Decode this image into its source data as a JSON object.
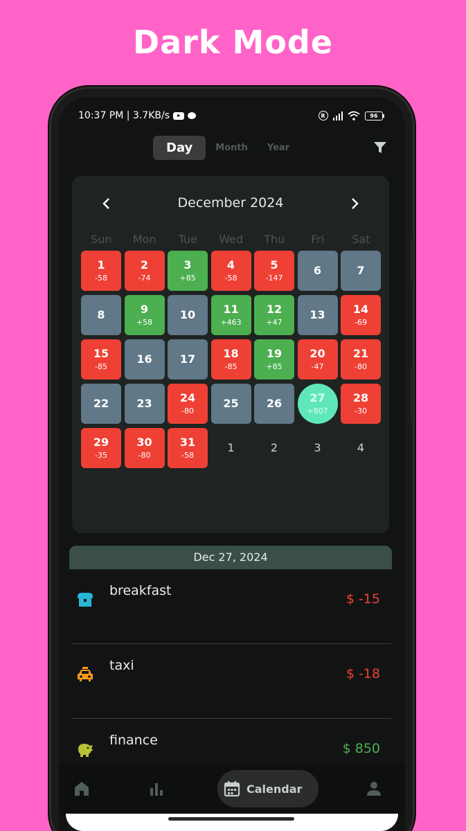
{
  "promo": {
    "title": "Dark Mode"
  },
  "status_bar": {
    "time_speed": "10:37 PM | 3.7KB/s",
    "r_badge": "R",
    "battery": "96"
  },
  "view_toggle": {
    "day": "Day",
    "month": "Month",
    "year": "Year",
    "active": "Day"
  },
  "calendar": {
    "month_title": "December 2024",
    "weekdays": [
      "Sun",
      "Mon",
      "Tue",
      "Wed",
      "Thu",
      "Fri",
      "Sat"
    ],
    "days": [
      {
        "num": "1",
        "amt": "-58",
        "status": "red"
      },
      {
        "num": "2",
        "amt": "-74",
        "status": "red"
      },
      {
        "num": "3",
        "amt": "+85",
        "status": "green"
      },
      {
        "num": "4",
        "amt": "-58",
        "status": "red"
      },
      {
        "num": "5",
        "amt": "-147",
        "status": "red"
      },
      {
        "num": "6",
        "amt": "",
        "status": "gray"
      },
      {
        "num": "7",
        "amt": "",
        "status": "gray"
      },
      {
        "num": "8",
        "amt": "",
        "status": "gray"
      },
      {
        "num": "9",
        "amt": "+58",
        "status": "green"
      },
      {
        "num": "10",
        "amt": "",
        "status": "gray"
      },
      {
        "num": "11",
        "amt": "+463",
        "status": "green"
      },
      {
        "num": "12",
        "amt": "+47",
        "status": "green"
      },
      {
        "num": "13",
        "amt": "",
        "status": "gray"
      },
      {
        "num": "14",
        "amt": "-69",
        "status": "red"
      },
      {
        "num": "15",
        "amt": "-85",
        "status": "red"
      },
      {
        "num": "16",
        "amt": "",
        "status": "gray"
      },
      {
        "num": "17",
        "amt": "",
        "status": "gray"
      },
      {
        "num": "18",
        "amt": "-85",
        "status": "red"
      },
      {
        "num": "19",
        "amt": "+85",
        "status": "green"
      },
      {
        "num": "20",
        "amt": "-47",
        "status": "red"
      },
      {
        "num": "21",
        "amt": "-80",
        "status": "red"
      },
      {
        "num": "22",
        "amt": "",
        "status": "gray"
      },
      {
        "num": "23",
        "amt": "",
        "status": "gray"
      },
      {
        "num": "24",
        "amt": "-80",
        "status": "red"
      },
      {
        "num": "25",
        "amt": "",
        "status": "gray"
      },
      {
        "num": "26",
        "amt": "",
        "status": "gray"
      },
      {
        "num": "27",
        "amt": "+807",
        "status": "today"
      },
      {
        "num": "28",
        "amt": "-30",
        "status": "red"
      },
      {
        "num": "29",
        "amt": "-35",
        "status": "red"
      },
      {
        "num": "30",
        "amt": "-80",
        "status": "red"
      },
      {
        "num": "31",
        "amt": "-58",
        "status": "red"
      },
      {
        "num": "1",
        "amt": "",
        "status": "next"
      },
      {
        "num": "2",
        "amt": "",
        "status": "next"
      },
      {
        "num": "3",
        "amt": "",
        "status": "next"
      },
      {
        "num": "4",
        "amt": "",
        "status": "next"
      }
    ]
  },
  "selected_date": "Dec 27, 2024",
  "transactions": [
    {
      "name": "breakfast",
      "amount": "$ -15",
      "type": "neg",
      "icon": "bread-icon",
      "icon_color": "#29b6d6"
    },
    {
      "name": "taxi",
      "amount": "$ -18",
      "type": "neg",
      "icon": "taxi-icon",
      "icon_color": "#f59a1e"
    },
    {
      "name": "finance",
      "amount": "$ 850",
      "type": "pos",
      "icon": "piggy-bank-icon",
      "icon_color": "#b8c234"
    }
  ],
  "bottom_nav": {
    "active_label": "Calendar",
    "items": [
      "home-icon",
      "chart-icon",
      "calendar-icon",
      "profile-icon"
    ]
  },
  "colors": {
    "background": "#ff63c8",
    "expense": "#ef4035",
    "income": "#4caf50",
    "neutral_day": "#607888",
    "today": "#5fe7b8"
  }
}
